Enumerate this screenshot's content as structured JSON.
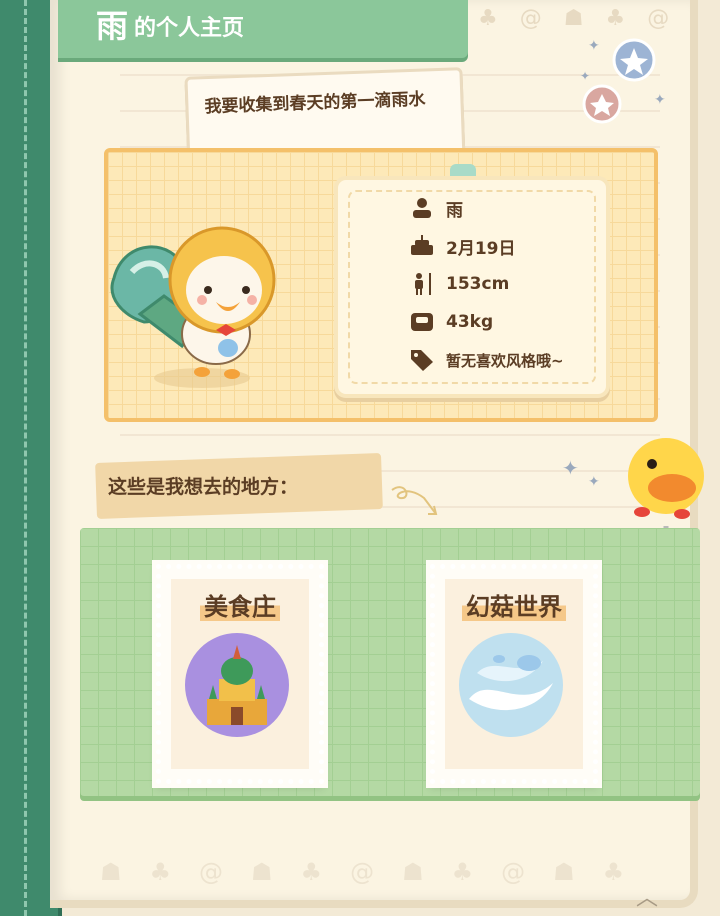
{
  "header": {
    "name": "雨",
    "suffix": "的个人主页"
  },
  "bubble": {
    "text": "我要收集到春天的第一滴雨水"
  },
  "profile": {
    "rows": [
      {
        "icon": "person-icon",
        "value": "雨"
      },
      {
        "icon": "birthday-cake-icon",
        "value": "2月19日"
      },
      {
        "icon": "height-icon",
        "value": "153cm"
      },
      {
        "icon": "scale-icon",
        "value": "43kg"
      },
      {
        "icon": "tag-icon",
        "value": "暂无喜欢风格哦~"
      }
    ]
  },
  "section": {
    "label": "这些是我想去的地方："
  },
  "destinations": [
    {
      "name": "美食庄",
      "art": "palace-icon"
    },
    {
      "name": "幻菇世界",
      "art": "cloud-swirl-icon"
    }
  ],
  "colors": {
    "primary_green": "#8bc79a",
    "spine_green": "#3f8a6c",
    "card_yellow": "#fde9b8",
    "text_brown": "#5b3d24"
  }
}
